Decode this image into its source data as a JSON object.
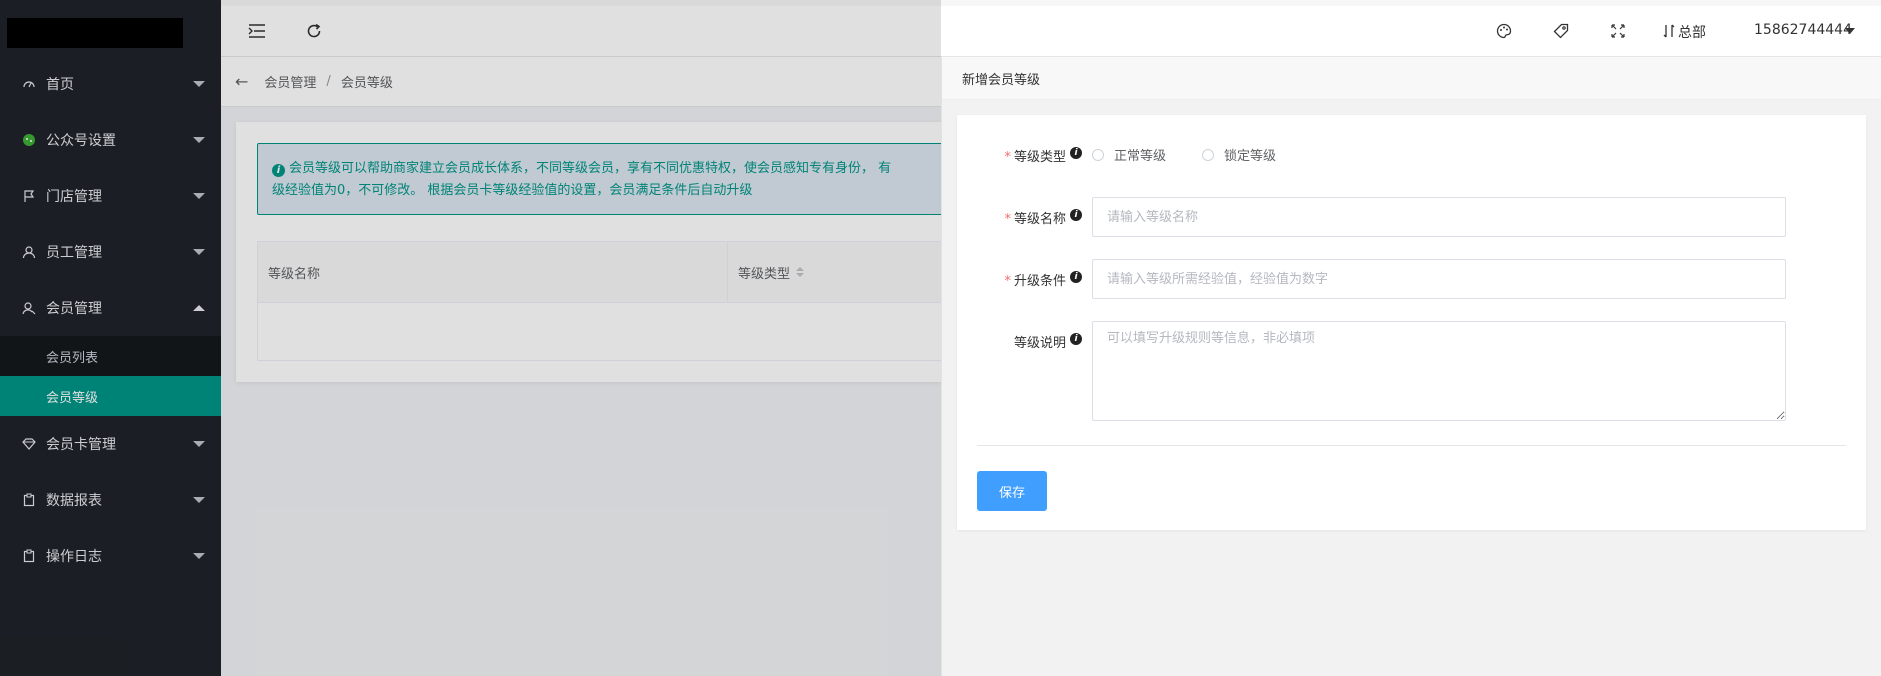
{
  "sidebar": {
    "items": [
      {
        "label": "首页",
        "icon": "dashboard-icon"
      },
      {
        "label": "公众号设置",
        "icon": "wechat-icon"
      },
      {
        "label": "门店管理",
        "icon": "flag-icon"
      },
      {
        "label": "员工管理",
        "icon": "user-icon"
      },
      {
        "label": "会员管理",
        "icon": "member-icon",
        "expanded": true,
        "children": [
          {
            "label": "会员列表"
          },
          {
            "label": "会员等级",
            "active": true
          }
        ]
      },
      {
        "label": "会员卡管理",
        "icon": "diamond-icon"
      },
      {
        "label": "数据报表",
        "icon": "clipboard-icon"
      },
      {
        "label": "操作日志",
        "icon": "clipboard-icon"
      }
    ]
  },
  "topbar": {
    "branch": "总部",
    "user": "15862744444"
  },
  "breadcrumb": {
    "items": [
      "会员管理",
      "会员等级"
    ]
  },
  "alert": {
    "line1": "会员等级可以帮助商家建立会员成长体系，不同等级会员，享有不同优惠特权，使会员感知专有身份， 有",
    "line2": "级经验值为0，不可修改。 根据会员卡等级经验值的设置，会员满足条件后自动升级"
  },
  "table": {
    "columns": [
      "等级名称",
      "等级类型"
    ]
  },
  "drawer": {
    "title": "新增会员等级",
    "fields": {
      "type": {
        "label": "等级类型",
        "options": [
          "正常等级",
          "锁定等级"
        ]
      },
      "name": {
        "label": "等级名称",
        "placeholder": "请输入等级名称",
        "value": ""
      },
      "condition": {
        "label": "升级条件",
        "placeholder": "请输入等级所需经验值，经验值为数字",
        "value": ""
      },
      "desc": {
        "label": "等级说明",
        "placeholder": "可以填写升级规则等信息，非必填项",
        "value": ""
      }
    },
    "save_label": "保存"
  },
  "colors": {
    "sidebar_bg": "#1f2329",
    "accent": "#009688",
    "primary_button": "#409eff",
    "required": "#f56c6c"
  }
}
